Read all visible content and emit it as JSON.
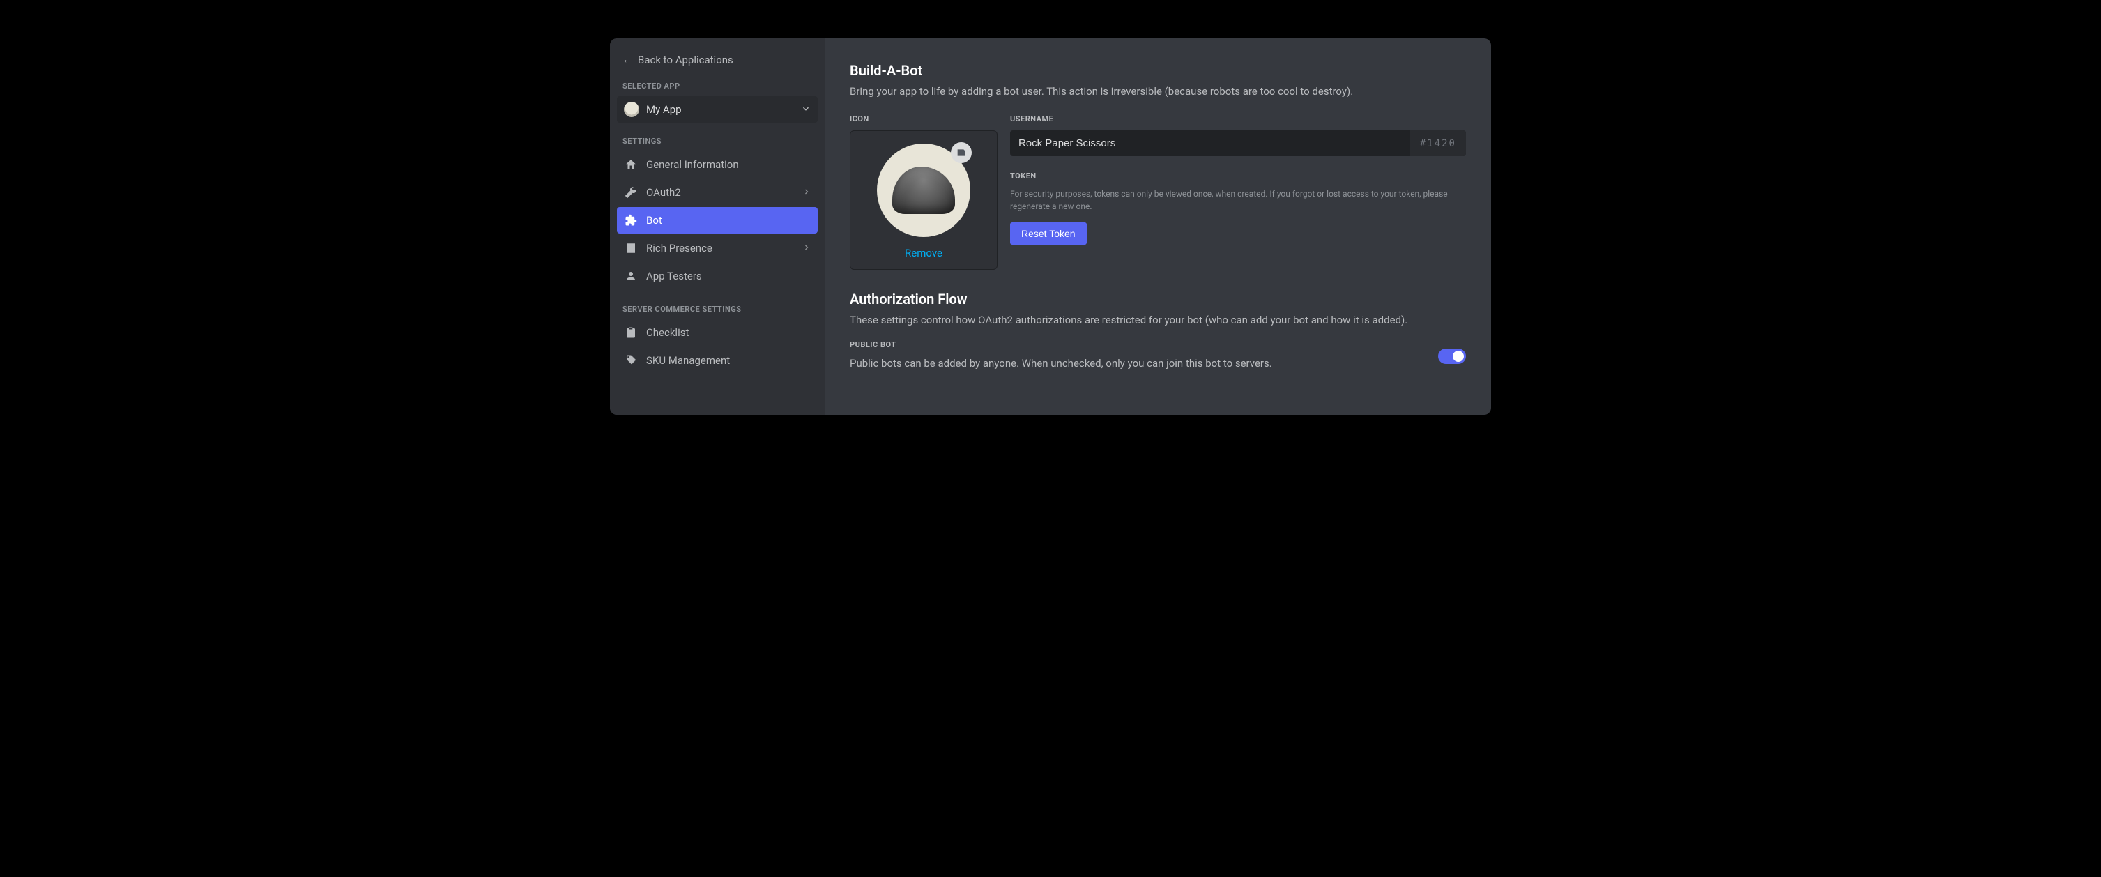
{
  "sidebar": {
    "back_label": "Back to Applications",
    "selected_app_header": "Selected App",
    "app_name": "My App",
    "settings_header": "Settings",
    "items": [
      {
        "label": "General Information",
        "has_sub": false
      },
      {
        "label": "OAuth2",
        "has_sub": true
      },
      {
        "label": "Bot",
        "has_sub": false
      },
      {
        "label": "Rich Presence",
        "has_sub": true
      },
      {
        "label": "App Testers",
        "has_sub": false
      }
    ],
    "commerce_header": "Server Commerce Settings",
    "commerce_items": [
      {
        "label": "Checklist"
      },
      {
        "label": "SKU Management"
      }
    ]
  },
  "main": {
    "title": "Build-A-Bot",
    "subtitle": "Bring your app to life by adding a bot user. This action is irreversible (because robots are too cool to destroy).",
    "icon_label": "Icon",
    "remove_label": "Remove",
    "username_label": "Username",
    "username_value": "Rock Paper Scissors",
    "discriminator": "#1420",
    "token_label": "Token",
    "token_help": "For security purposes, tokens can only be viewed once, when created. If you forgot or lost access to your token, please regenerate a new one.",
    "reset_token_label": "Reset Token",
    "auth_title": "Authorization Flow",
    "auth_subtitle": "These settings control how OAuth2 authorizations are restricted for your bot (who can add your bot and how it is added).",
    "public_bot_label": "Public Bot",
    "public_bot_desc": "Public bots can be added by anyone. When unchecked, only you can join this bot to servers.",
    "public_bot_on": true
  }
}
